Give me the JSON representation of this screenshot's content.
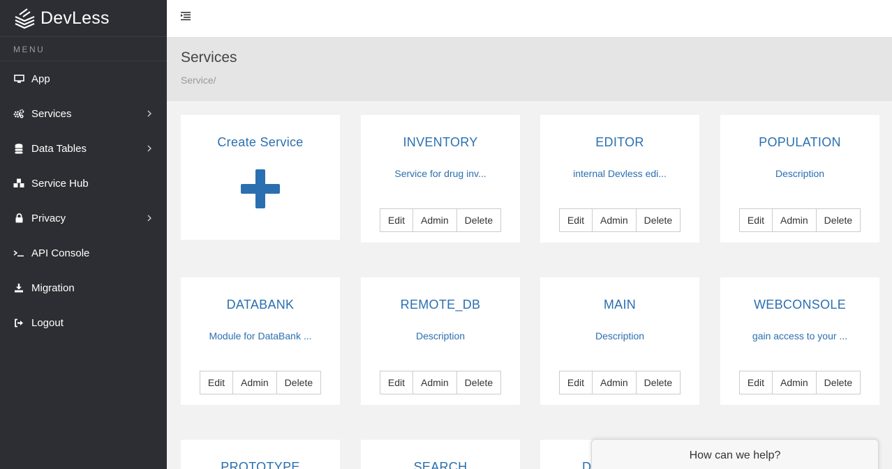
{
  "brand": {
    "name": "DevLess"
  },
  "sidebar": {
    "heading": "MENU",
    "items": [
      {
        "label": "App",
        "icon": "desktop-icon"
      },
      {
        "label": "Services",
        "icon": "cogs-icon"
      },
      {
        "label": "Data Tables",
        "icon": "database-icon"
      },
      {
        "label": "Service Hub",
        "icon": "cubes-icon"
      },
      {
        "label": "Privacy",
        "icon": "lock-icon"
      },
      {
        "label": "API Console",
        "icon": "terminal-icon"
      },
      {
        "label": "Migration",
        "icon": "download-icon"
      },
      {
        "label": "Logout",
        "icon": "sign-out-icon"
      }
    ]
  },
  "page": {
    "title": "Services",
    "breadcrumb": "Service/"
  },
  "buttons": {
    "edit": "Edit",
    "admin": "Admin",
    "delete": "Delete"
  },
  "create_card": {
    "title": "Create Service"
  },
  "services": [
    {
      "name": "INVENTORY",
      "description": "Service for drug inv..."
    },
    {
      "name": "EDITOR",
      "description": "internal Devless edi..."
    },
    {
      "name": "POPULATION",
      "description": "Description"
    },
    {
      "name": "DATABANK",
      "description": "Module for DataBank ..."
    },
    {
      "name": "REMOTE_DB",
      "description": "Description"
    },
    {
      "name": "MAIN",
      "description": "Description"
    },
    {
      "name": "WEBCONSOLE",
      "description": "gain access to your ..."
    },
    {
      "name": "PROTOTYPE",
      "description": ""
    },
    {
      "name": "SEARCH",
      "description": ""
    },
    {
      "name": "D",
      "description": ""
    }
  ],
  "help_widget": {
    "label": "How can we help?"
  },
  "colors": {
    "sidebar": "#2c2e33",
    "accent": "#2a6fb0",
    "header_bg": "#e5e5e5",
    "body_bg": "#f2f2f2"
  }
}
